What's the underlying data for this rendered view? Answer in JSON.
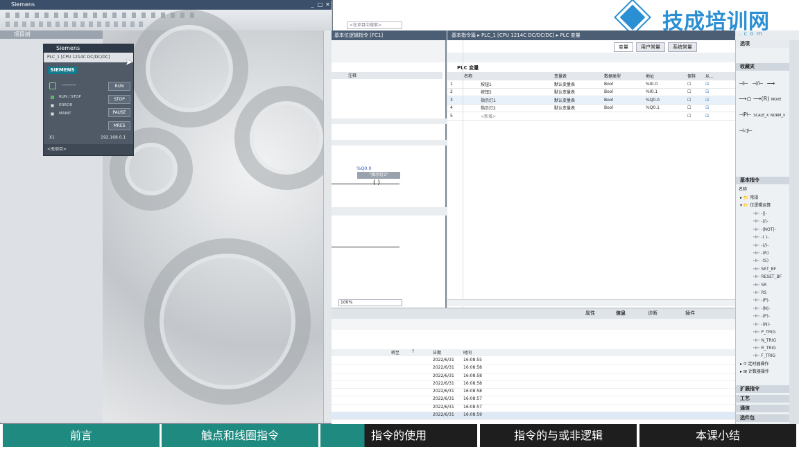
{
  "simulator": {
    "title": "Siemens",
    "project_tree_label": "项目树",
    "panel_title": "Siemens",
    "panel_device": "PLC_1 [CPU 1214C DC/DC/DC]",
    "brand": "SIEMENS",
    "status_dashes": "--------",
    "leds": [
      "RUN / STOP",
      "ERROR",
      "MAINT"
    ],
    "buttons": [
      "RUN",
      "STOP",
      "PAUSE",
      "MRES"
    ],
    "port": "X1",
    "ip": "192.168.0.1",
    "no_project": "<无项目>"
  },
  "portal": {
    "search_placeholder": "<在项目中搜索>",
    "fc1_tab": "基本位逻辑指令 [FC1]",
    "comment_col": "注释",
    "network_var": "%Q0.0",
    "network_name": "\"指示灯1\"",
    "zoom": "100%",
    "breadcrumb": "基本指令篇 ▸ PLC_1 [CPU 1214C DC/DC/DC] ▸ PLC 变量",
    "tabs": [
      "变量",
      "用户常量",
      "系统常量"
    ],
    "table_title": "PLC 变量",
    "columns": [
      "名称",
      "变量表",
      "数据类型",
      "地址",
      "保持",
      "从..."
    ],
    "rows": [
      {
        "n": "1",
        "name": "按钮1",
        "table": "默认变量表",
        "type": "Bool",
        "addr": "%I0.0"
      },
      {
        "n": "2",
        "name": "按钮2",
        "table": "默认变量表",
        "type": "Bool",
        "addr": "%I0.1"
      },
      {
        "n": "3",
        "name": "指示灯1",
        "table": "默认变量表",
        "type": "Bool",
        "addr": "%Q0.0"
      },
      {
        "n": "4",
        "name": "指示灯2",
        "table": "默认变量表",
        "type": "Bool",
        "addr": "%Q0.1"
      },
      {
        "n": "5",
        "name": "<新增>",
        "table": "",
        "type": "",
        "addr": ""
      }
    ],
    "info_tabs": [
      "属性",
      "信息",
      "诊断",
      "插件"
    ],
    "log_headers": [
      "转至",
      "?",
      "日期",
      "时间"
    ],
    "log_rows": [
      {
        "date": "2022/6/31",
        "time": "16:08:55"
      },
      {
        "date": "2022/6/31",
        "time": "16:08:58"
      },
      {
        "date": "2022/6/31",
        "time": "16:08:58"
      },
      {
        "date": "2022/6/31",
        "time": "16:08:58"
      },
      {
        "date": "2022/6/31",
        "time": "16:08:58"
      },
      {
        "date": "2022/6/31",
        "time": "16:08:57"
      },
      {
        "date": "2022/6/31",
        "time": "16:08:57"
      },
      {
        "date": "2022/6/31",
        "time": "16:08:59"
      }
    ]
  },
  "instructions": {
    "options": "选项",
    "favorites": "收藏夹",
    "basic": "基本指令",
    "name_col": "名称",
    "groups": [
      "常规",
      "位逻辑运算"
    ],
    "items": [
      "-||-",
      "-|/|-",
      "-|NOT|-",
      "-( )-",
      "-(/)-",
      "-(R)",
      "-(S)",
      "SET_BF",
      "RESET_BF",
      "SR",
      "RS",
      "-|P|-",
      "-|N|-",
      "-(P)-",
      "-(N)-",
      "P_TRIG",
      "N_TRIG",
      "R_TRIG",
      "F_TRIG"
    ],
    "more_groups": [
      "定时器操作",
      "计数器操作"
    ],
    "sections": [
      "扩展指令",
      "工艺",
      "通信",
      "选件包"
    ],
    "fav_items": [
      "MOVE",
      "SCALE_X",
      "NORM_X"
    ]
  },
  "logo": {
    "text": "技成培训网",
    "url": "w w w . j c p e i x u n . c o m",
    "tagline": "Totally Integrated Automation PORTAL"
  },
  "nav": [
    "前言",
    "触点和线圈指令",
    "指令的使用",
    "指令的与或非逻辑",
    "本课小结"
  ],
  "colors": {
    "teal": "#1f8a80",
    "dark": "#1e1e1e"
  }
}
